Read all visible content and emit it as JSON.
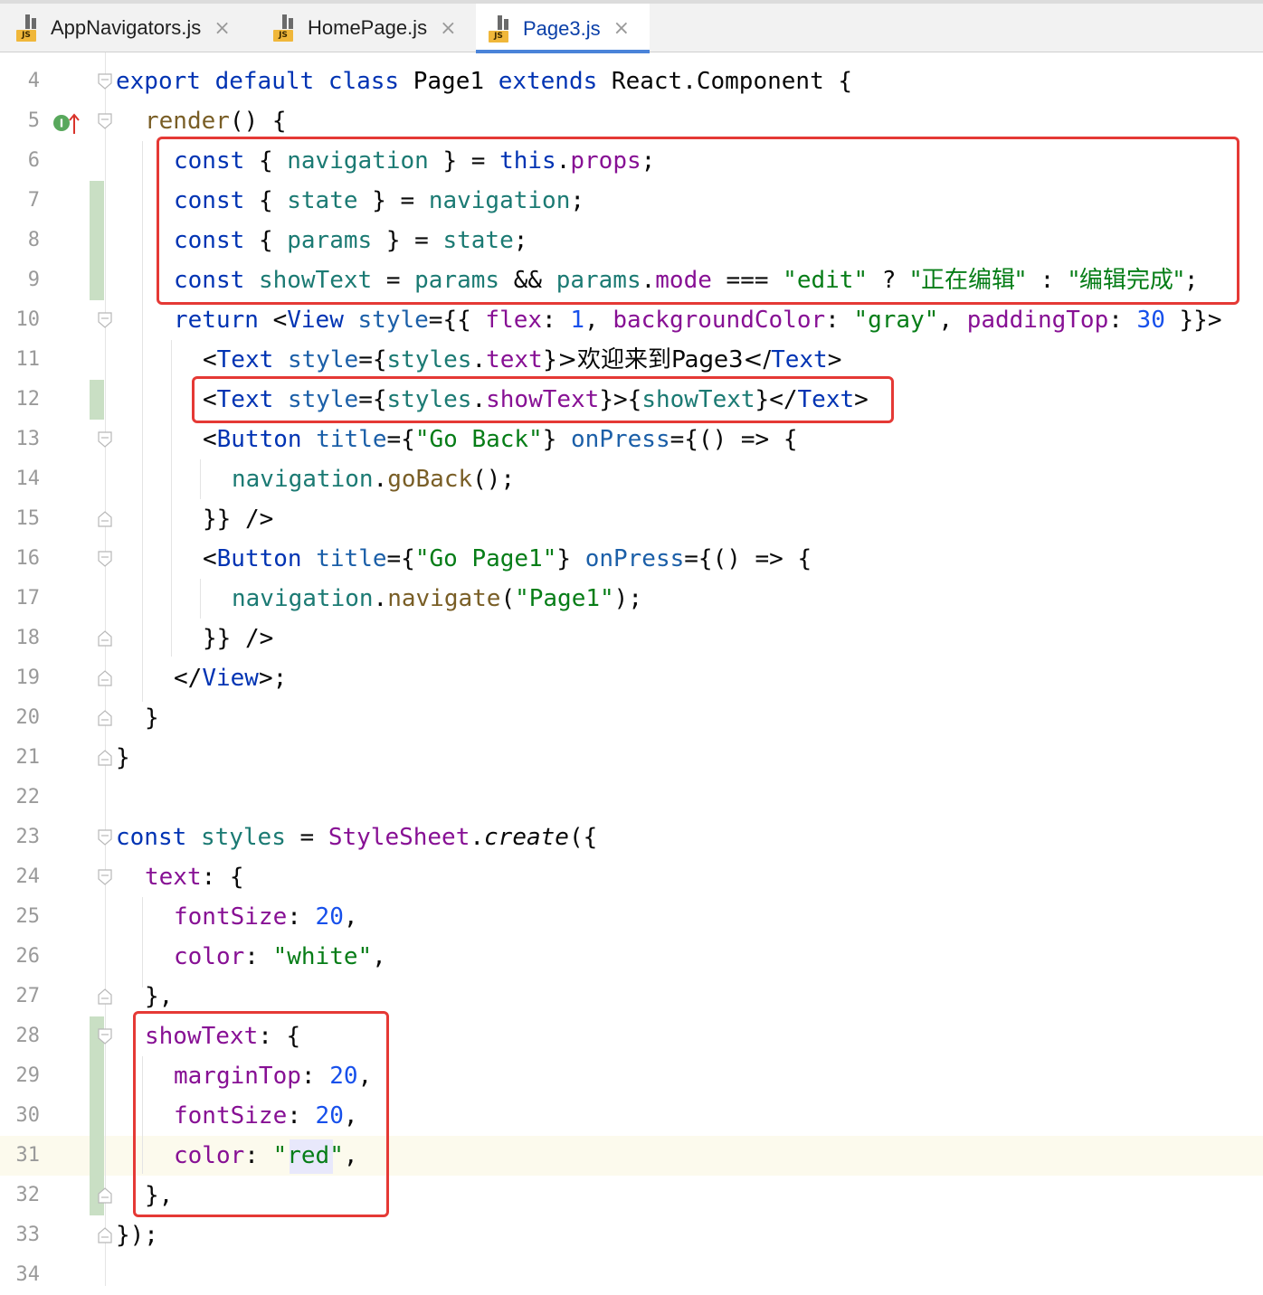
{
  "tabs": [
    {
      "label": "AppNavigators.js",
      "icon": "js-file-icon",
      "active": false
    },
    {
      "label": "HomePage.js",
      "icon": "js-file-icon",
      "active": false
    },
    {
      "label": "Page3.js",
      "icon": "js-file-icon",
      "active": true
    }
  ],
  "tab_close_symbol": "×",
  "js_badge": "JS",
  "line_numbers": [
    "4",
    "5",
    "6",
    "7",
    "8",
    "9",
    "10",
    "11",
    "12",
    "13",
    "14",
    "15",
    "16",
    "17",
    "18",
    "19",
    "20",
    "21",
    "22",
    "23",
    "24",
    "25",
    "26",
    "27",
    "28",
    "29",
    "30",
    "31",
    "32",
    "33",
    "34"
  ],
  "code": {
    "l4": {
      "a": "export",
      "b": "default",
      "c": "class",
      "d": "Page1",
      "e": "extends",
      "f": "React.Component {"
    },
    "l5": {
      "a": "render",
      "b": "() {"
    },
    "l6": {
      "a": "const",
      "b": "{",
      "c": "navigation",
      "d": "} =",
      "e": "this",
      "f": ".",
      "g": "props",
      ";": ";"
    },
    "l7": {
      "a": "const",
      "b": "{",
      "c": "state",
      "d": "} =",
      "e": "navigation",
      ";": ";"
    },
    "l8": {
      "a": "const",
      "b": "{",
      "c": "params",
      "d": "} =",
      "e": "state",
      ";": ";"
    },
    "l9": {
      "a": "const",
      "b": "showText",
      "c": "=",
      "d": "params",
      "e": "&&",
      "f": "params",
      "g": ".",
      "h": "mode",
      "i": "===",
      "j": "\"edit\"",
      "k": "?",
      "l": "\"正在编辑\"",
      "m": ":",
      "n": "\"编辑完成\"",
      ";": ";"
    },
    "l10": {
      "a": "return",
      "b": "<",
      "c": "View",
      "d": "style",
      "e": "={{",
      "f": "flex",
      "g": ":",
      "h": "1",
      "i": ",",
      "j": "backgroundColor",
      "k": ":",
      "l": "\"gray\"",
      "m": ",",
      "n": "paddingTop",
      "o": ":",
      "p": "30",
      "q": "}}>"
    },
    "l11": {
      "a": "<",
      "b": "Text",
      "c": "style",
      "d": "={",
      "e": "styles",
      "f": ".",
      "g": "text",
      "h": "}>欢迎来到Page3</",
      "i": "Text",
      "j": ">"
    },
    "l12": {
      "a": "<",
      "b": "Text",
      "c": "style",
      "d": "={",
      "e": "styles",
      "f": ".",
      "g": "showText",
      "h": "}>{",
      "i": "showText",
      "j": "}</",
      "k": "Text",
      "l": ">"
    },
    "l13": {
      "a": "<",
      "b": "Button",
      "c": "title",
      "d": "={",
      "e": "\"Go Back\"",
      "f": "}",
      "g": "onPress",
      "h": "={() => {"
    },
    "l14": {
      "a": "navigation",
      "b": ".",
      "c": "goBack",
      "d": "();"
    },
    "l15": {
      "a": "}} />"
    },
    "l16": {
      "a": "<",
      "b": "Button",
      "c": "title",
      "d": "={",
      "e": "\"Go Page1\"",
      "f": "}",
      "g": "onPress",
      "h": "={() => {"
    },
    "l17": {
      "a": "navigation",
      "b": ".",
      "c": "navigate",
      "d": "(",
      "e": "\"Page1\"",
      "f": ");"
    },
    "l18": {
      "a": "}} />"
    },
    "l19": {
      "a": "</",
      "b": "View",
      "c": ">;"
    },
    "l20": {
      "a": "}"
    },
    "l21": {
      "a": "}"
    },
    "l23": {
      "a": "const",
      "b": "styles",
      "c": "=",
      "d": "StyleSheet",
      "e": ".",
      "f": "create",
      "g": "({"
    },
    "l24": {
      "a": "text",
      "b": ": {"
    },
    "l25": {
      "a": "fontSize",
      "b": ":",
      "c": "20",
      "d": ","
    },
    "l26": {
      "a": "color",
      "b": ":",
      "c": "\"white\"",
      "d": ","
    },
    "l27": {
      "a": "},"
    },
    "l28": {
      "a": "showText",
      "b": ": {"
    },
    "l29": {
      "a": "marginTop",
      "b": ":",
      "c": "20",
      "d": ","
    },
    "l30": {
      "a": "fontSize",
      "b": ":",
      "c": "20",
      "d": ","
    },
    "l31": {
      "a": "color",
      "b": ":",
      "c": "\"",
      "d": "red",
      "e": "\"",
      "f": ","
    },
    "l32": {
      "a": "},"
    },
    "l33": {
      "a": "});"
    }
  },
  "colors": {
    "keyword": "#0033b3",
    "string": "#067d17",
    "number": "#1750eb",
    "property": "#871094",
    "variable": "#1b7a73",
    "annotation_box": "#e53935",
    "vcs_changed": "#c9dfc4",
    "active_tab_underline": "#4a83d9"
  }
}
